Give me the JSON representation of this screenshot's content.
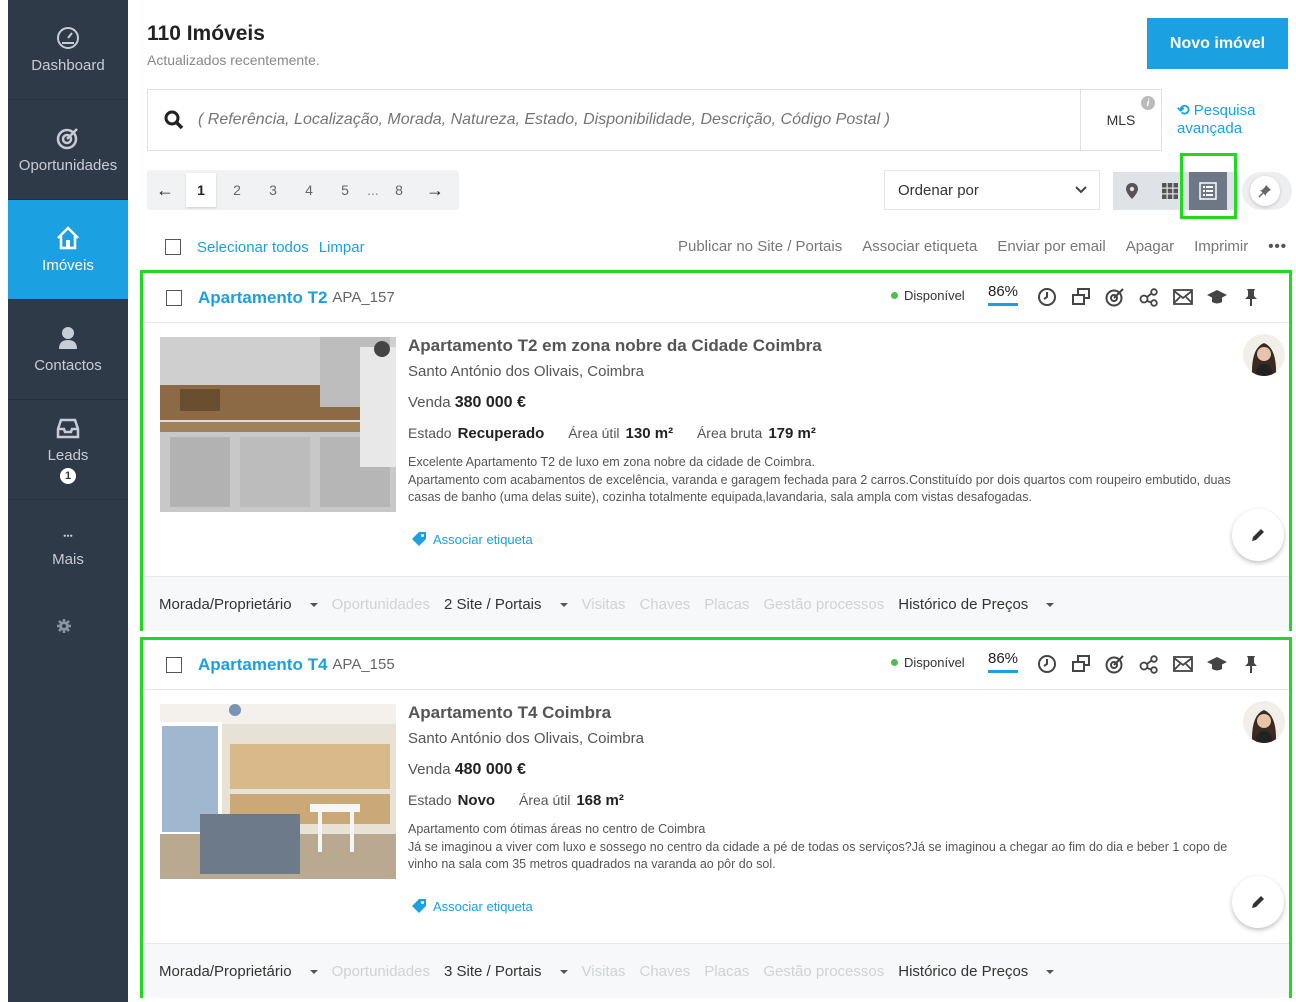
{
  "sidebar": {
    "items": [
      {
        "label": "Dashboard"
      },
      {
        "label": "Oportunidades"
      },
      {
        "label": "Imóveis"
      },
      {
        "label": "Contactos"
      },
      {
        "label": "Leads",
        "badge": "1"
      },
      {
        "label": "Mais"
      }
    ]
  },
  "header": {
    "title": "110 Imóveis",
    "subtitle": "Actualizados recentemente.",
    "new_button": "Novo imóvel"
  },
  "search": {
    "placeholder": "( Referência, Localização, Morada, Natureza, Estado, Disponibilidade, Descrição, Código Postal )",
    "mls": "MLS",
    "mls_info": "i",
    "advanced": "Pesquisa avançada"
  },
  "pagination": {
    "pages": [
      "1",
      "2",
      "3",
      "4",
      "5",
      "...",
      "8"
    ]
  },
  "sort": {
    "label": "Ordenar por"
  },
  "toolbar": {
    "select_all": "Selecionar todos",
    "clear": "Limpar",
    "actions": [
      "Publicar no Site / Portais",
      "Associar etiqueta",
      "Enviar por email",
      "Apagar",
      "Imprimir",
      "•••"
    ]
  },
  "colors": {
    "accent": "#1ba0e2",
    "sidebar": "#2f3a48",
    "available": "#4cbf4c",
    "highlight": "#22d922"
  },
  "listings": [
    {
      "title": "Apartamento T2",
      "ref": "APA_157",
      "status": "Disponível",
      "completeness": "86%",
      "headline": "Apartamento T2 em zona nobre da Cidade Coimbra",
      "location": "Santo António dos Olivais, Coimbra",
      "price_label": "Venda",
      "price": "380 000 €",
      "specs": [
        {
          "label": "Estado",
          "value": "Recuperado"
        },
        {
          "label": "Área útil",
          "value": "130 m²"
        },
        {
          "label": "Área bruta",
          "value": "179 m²"
        }
      ],
      "description": [
        "Excelente Apartamento T2 de luxo em zona nobre da cidade de Coimbra.",
        "Apartamento com acabamentos de excelência, varanda e garagem fechada para 2 carros.Constituído por dois quartos com roupeiro embutido, duas casas de banho (uma delas suite), cozinha totalmente equipada,lavandaria, sala ampla com vistas desafogadas."
      ],
      "tag_link": "Associar etiqueta",
      "footer": {
        "owner": "Morada/Proprietário",
        "opportunities": "Oportunidades",
        "portals": "2 Site / Portais",
        "visits": "Visitas",
        "keys": "Chaves",
        "signs": "Placas",
        "processes": "Gestão processos",
        "price_history": "Histórico de Preços"
      }
    },
    {
      "title": "Apartamento T4",
      "ref": "APA_155",
      "status": "Disponível",
      "completeness": "86%",
      "headline": "Apartamento T4 Coimbra",
      "location": "Santo António dos Olivais, Coimbra",
      "price_label": "Venda",
      "price": "480 000 €",
      "specs": [
        {
          "label": "Estado",
          "value": "Novo"
        },
        {
          "label": "Área útil",
          "value": "168 m²"
        }
      ],
      "description": [
        "Apartamento com ótimas áreas no centro de Coimbra",
        "Já se imaginou a viver com luxo e sossego no centro da cidade a pé de todas os serviços?Já se imaginou a chegar ao fim do dia e beber 1 copo de vinho na sala com 35 metros quadrados na varanda ao pôr do sol."
      ],
      "tag_link": "Associar etiqueta",
      "footer": {
        "owner": "Morada/Proprietário",
        "opportunities": "Oportunidades",
        "portals": "3 Site / Portais",
        "visits": "Visitas",
        "keys": "Chaves",
        "signs": "Placas",
        "processes": "Gestão processos",
        "price_history": "Histórico de Preços"
      }
    }
  ]
}
